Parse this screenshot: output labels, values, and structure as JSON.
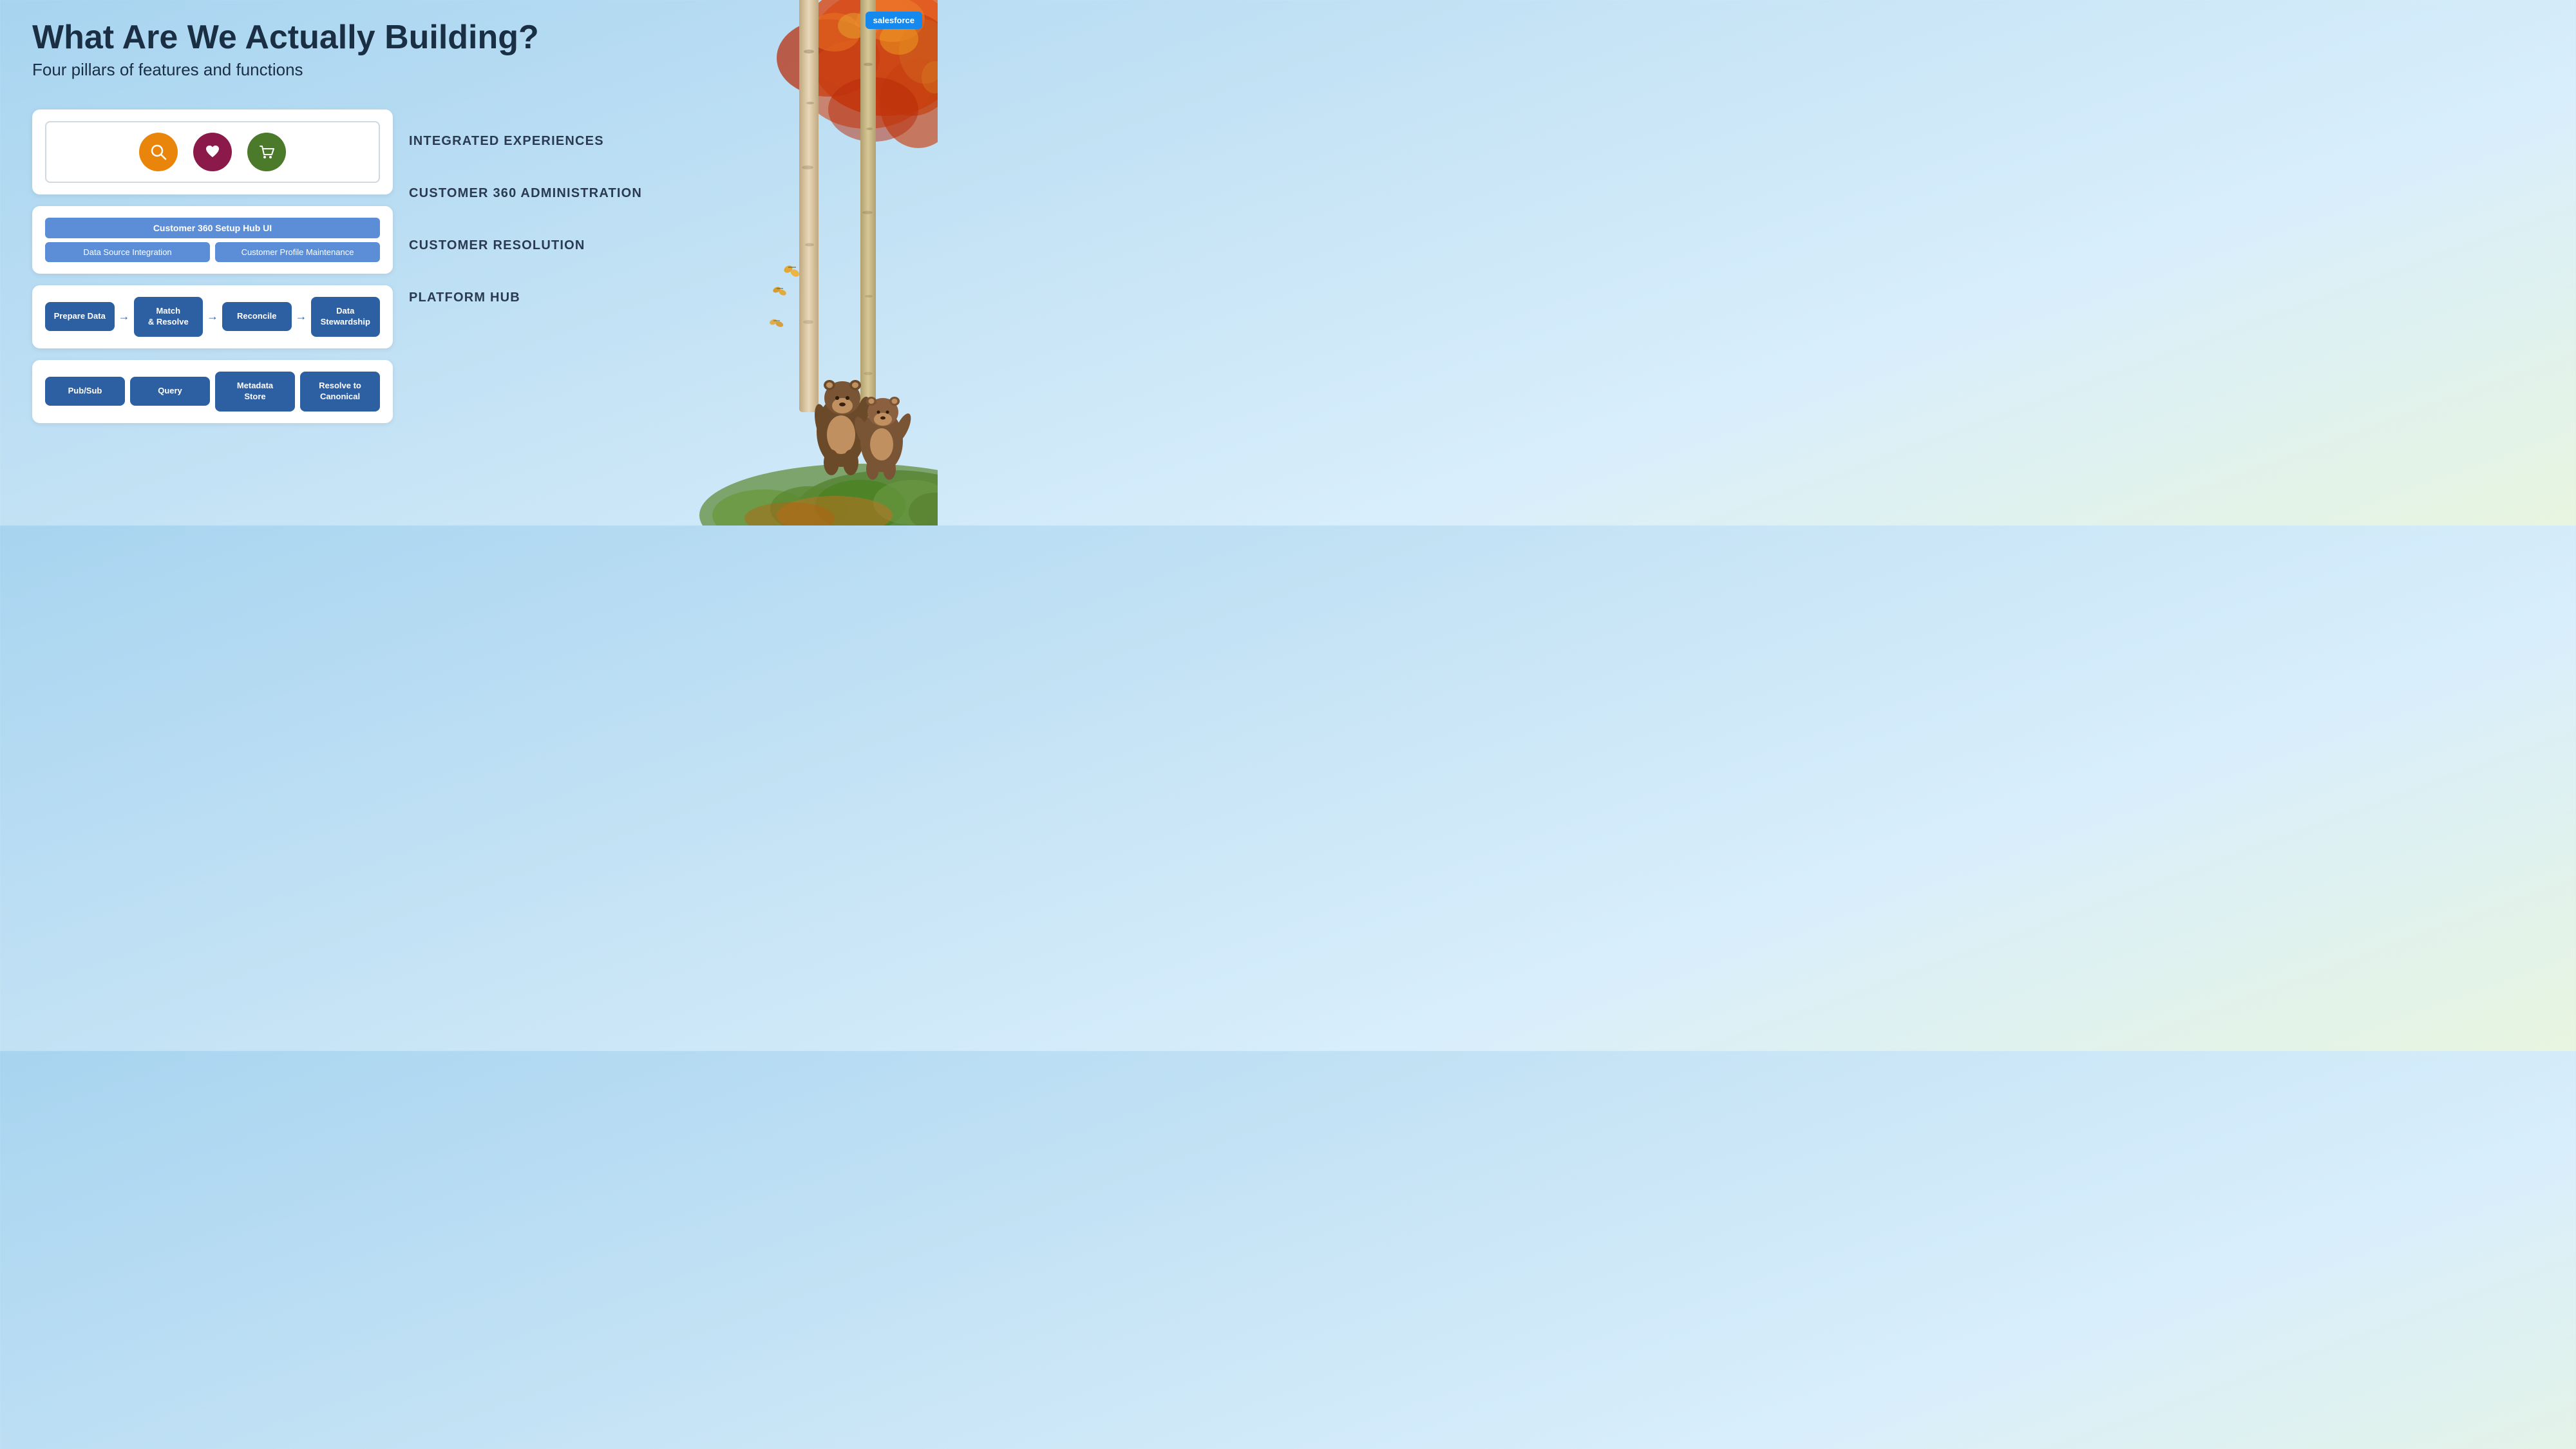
{
  "logo": {
    "text": "salesforce"
  },
  "title": {
    "main": "What Are We Actually Building?",
    "sub": "Four pillars of features and functions"
  },
  "pillars": [
    {
      "id": "integrated-experiences",
      "icons": [
        {
          "name": "search",
          "color": "orange",
          "symbol": "🔍"
        },
        {
          "name": "heart",
          "color": "maroon",
          "symbol": "♡"
        },
        {
          "name": "cart",
          "color": "green",
          "symbol": "🛒"
        }
      ],
      "label": "INTEGRATED EXPERIENCES"
    },
    {
      "id": "customer-360-admin",
      "topBar": "Customer 360 Setup Hub UI",
      "subBars": [
        "Data Source Integration",
        "Customer Profile Maintenance"
      ],
      "label": "CUSTOMER 360 ADMINISTRATION"
    },
    {
      "id": "customer-resolution",
      "blocks": [
        "Prepare Data",
        "Match\n& Resolve",
        "Reconcile",
        "Data\nStewardship"
      ],
      "label": "CUSTOMER RESOLUTION"
    },
    {
      "id": "platform-hub",
      "blocks": [
        "Pub/Sub",
        "Query",
        "Metadata\nStore",
        "Resolve to\nCanonical"
      ],
      "label": "PLATFORM HUB"
    }
  ]
}
